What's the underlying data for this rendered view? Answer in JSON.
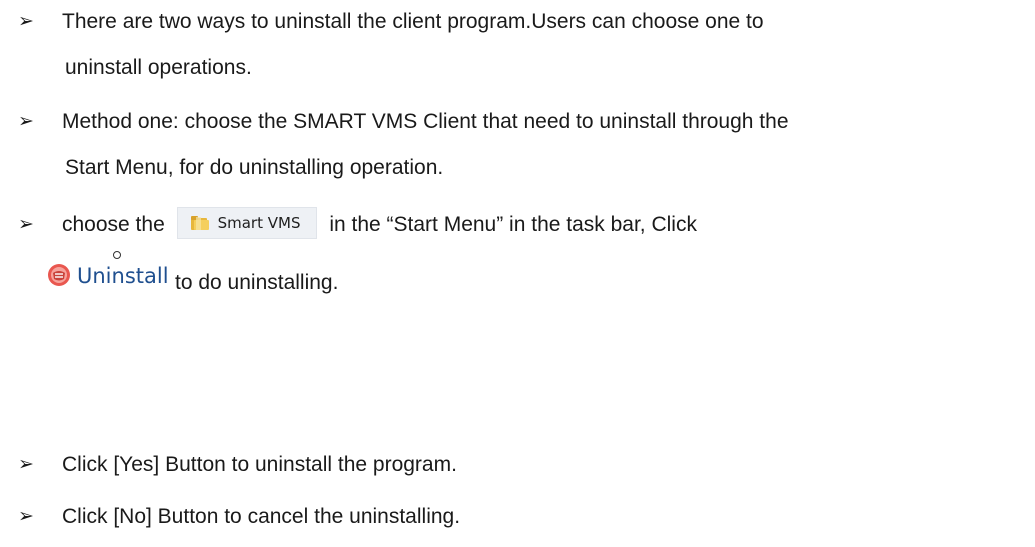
{
  "bullet_glyph": "➢",
  "items": [
    {
      "line1": "There are two ways to uninstall the client program.Users can choose one to",
      "line2": "uninstall operations."
    },
    {
      "line1": "Method one: choose the SMART VMS Client that need to uninstall through the",
      "line2": "Start Menu, for do uninstalling operation."
    },
    {
      "before_chip": "choose the",
      "chip_label": "Smart VMS",
      "after_chip": "in the “Start Menu” in the task bar,   Click",
      "uninstall_label": "Uninstall",
      "after_uninstall": "to do uninstalling."
    },
    {
      "line1": "Click [Yes] Button to uninstall the program."
    },
    {
      "line1": "Click [No] Button to cancel the uninstalling."
    }
  ],
  "icons": {
    "chip_icon": "folder-icon",
    "uninstall_icon": "uninstall-icon"
  }
}
